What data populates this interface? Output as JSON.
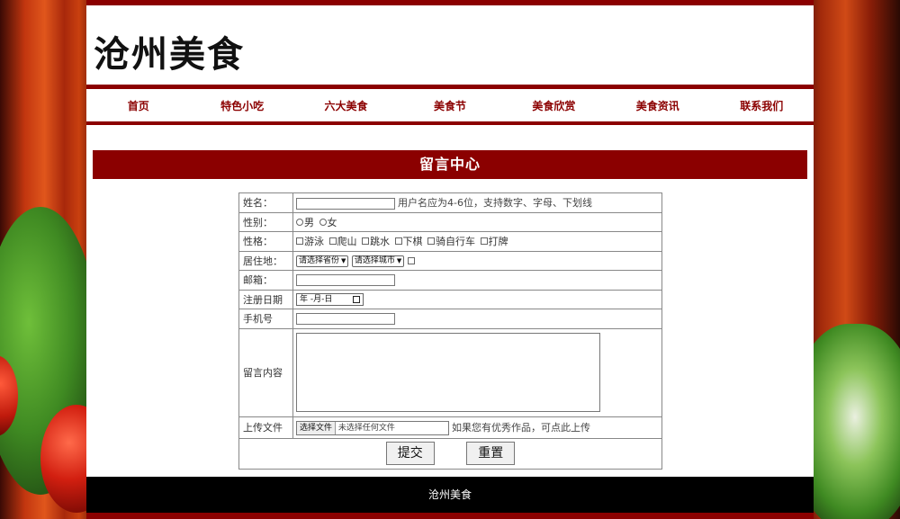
{
  "site": {
    "title": "沧州美食"
  },
  "nav": {
    "items": [
      {
        "label": "首页"
      },
      {
        "label": "特色小吃"
      },
      {
        "label": "六大美食"
      },
      {
        "label": "美食节"
      },
      {
        "label": "美食欣赏"
      },
      {
        "label": "美食资讯"
      },
      {
        "label": "联系我们"
      }
    ]
  },
  "section": {
    "title": "留言中心"
  },
  "form": {
    "name": {
      "label": "姓名：",
      "value": "",
      "hint": "用户名应为4-6位，支持数字、字母、下划线"
    },
    "gender": {
      "label": "性别：",
      "options": [
        "男",
        "女"
      ]
    },
    "hobbies": {
      "label": "性格：",
      "options": [
        "游泳",
        "爬山",
        "跳水",
        "下棋",
        "骑自行车",
        "打牌"
      ]
    },
    "residence": {
      "label": "居住地：",
      "province": "请选择省份",
      "city": "请选择城市"
    },
    "email": {
      "label": "邮箱：",
      "value": ""
    },
    "regdate": {
      "label": "注册日期",
      "placeholder": "年 -月-日"
    },
    "phone": {
      "label": "手机号",
      "value": ""
    },
    "message": {
      "label": "留言内容",
      "value": ""
    },
    "upload": {
      "label": "上传文件",
      "button": "选择文件",
      "status": "未选择任何文件",
      "hint": "如果您有优秀作品，可点此上传"
    },
    "submit": "提交",
    "reset": "重置"
  },
  "footer": {
    "text": "沧州美食"
  },
  "colors": {
    "primary": "#8b0000",
    "footer_bg": "#000000"
  }
}
